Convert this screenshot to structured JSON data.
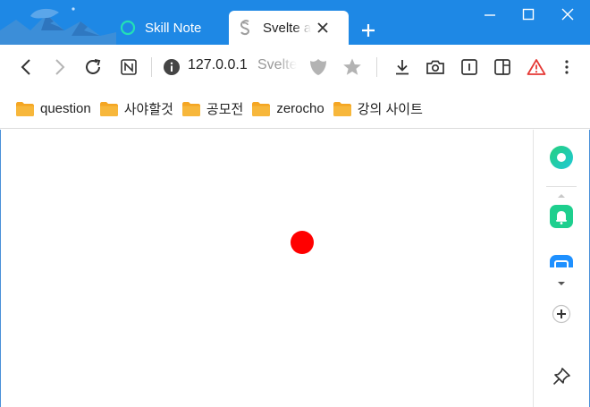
{
  "tabs": [
    {
      "title": "Skill Note",
      "active": false,
      "icon": "ring-icon"
    },
    {
      "title": "Svelte app",
      "active": true,
      "icon": "svelte-icon"
    }
  ],
  "toolbar": {
    "url": "127.0.0.1",
    "page_title": "Svelte app"
  },
  "bookmarks": [
    {
      "label": "question"
    },
    {
      "label": "사야할것"
    },
    {
      "label": "공모전"
    },
    {
      "label": "zerocho"
    },
    {
      "label": "강의 사이트"
    }
  ],
  "content": {
    "dot_color": "#ff0000"
  },
  "colors": {
    "accent": "#1e88e5",
    "warning": "#e53935",
    "sidebar_green": "#1ecf8e",
    "sidebar_blue": "#1e90ff"
  }
}
